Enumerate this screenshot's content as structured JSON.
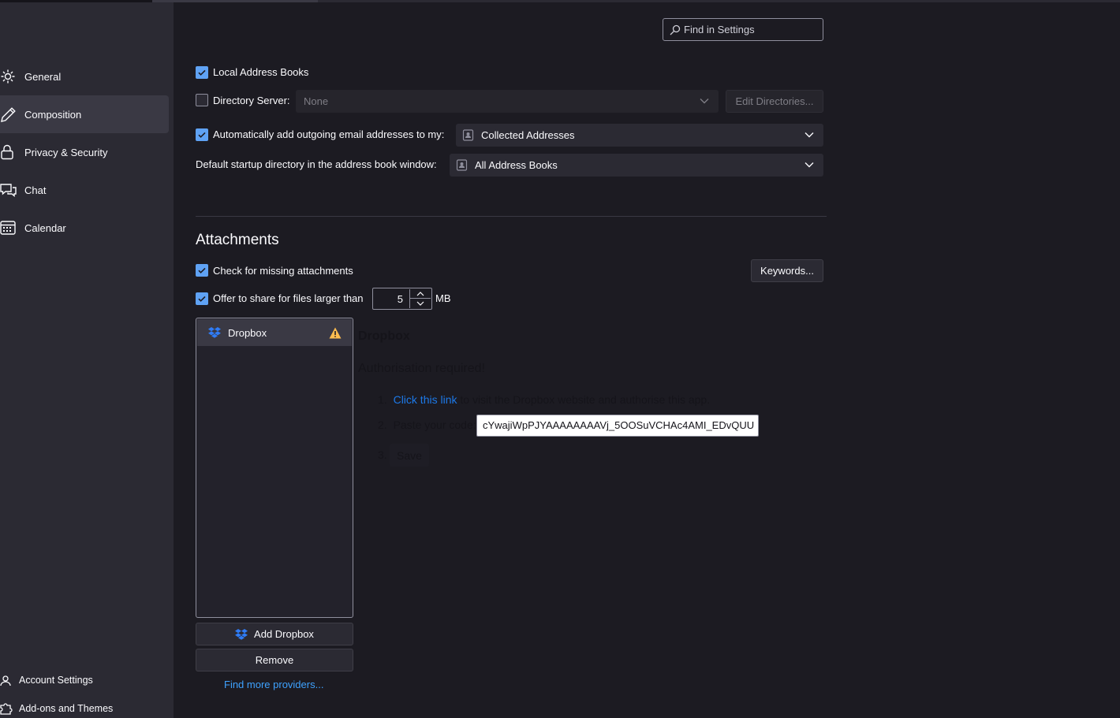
{
  "search": {
    "placeholder": "Find in Settings"
  },
  "sidebar": {
    "items": [
      {
        "label": "General",
        "icon": "gear-icon"
      },
      {
        "label": "Composition",
        "icon": "pencil-icon"
      },
      {
        "label": "Privacy & Security",
        "icon": "lock-icon"
      },
      {
        "label": "Chat",
        "icon": "chat-icon"
      },
      {
        "label": "Calendar",
        "icon": "calendar-icon"
      }
    ],
    "selected": "Composition",
    "bottom": [
      {
        "label": "Account Settings",
        "icon": "account-icon"
      },
      {
        "label": "Add-ons and Themes",
        "icon": "puzzle-icon"
      }
    ]
  },
  "addressing": {
    "local_books_label": "Local Address Books",
    "local_books_checked": true,
    "directory_server_label": "Directory Server:",
    "directory_server_checked": false,
    "directory_server_value": "None",
    "edit_directories_label": "Edit Directories...",
    "auto_add_label": "Automatically add outgoing email addresses to my:",
    "auto_add_checked": true,
    "auto_add_value": "Collected Addresses",
    "default_dir_label": "Default startup directory in the address book window:",
    "default_dir_value": "All Address Books"
  },
  "attachments": {
    "heading": "Attachments",
    "missing_label": "Check for missing attachments",
    "missing_checked": true,
    "keywords_label": "Keywords...",
    "offer_label": "Offer to share for files larger than",
    "offer_checked": true,
    "size_value": "5",
    "size_unit": "MB",
    "providers": [
      {
        "label": "Dropbox",
        "warning": true
      }
    ],
    "add_label": "Add Dropbox",
    "remove_label": "Remove",
    "find_more_label": "Find more providers..."
  },
  "pane": {
    "title": "Dropbox",
    "subtitle": "Authorisation required!",
    "step1_num": "1.",
    "step1_link": "Click this link",
    "step1_rest": " to visit the Dropbox website and authorise this app.",
    "step2_num": "2.",
    "step2_label": "Paste your code:",
    "code_value": "cYwajiWpPJYAAAAAAAAVj_5OOSuVCHAc4AMI_EDvQUU",
    "step3_num": "3.",
    "save_label": "Save"
  },
  "colors": {
    "accent": "#5fa2f4",
    "link": "#3ea2ff",
    "warning": "#ffbd4f",
    "dropbox": "#2f7cf6"
  }
}
